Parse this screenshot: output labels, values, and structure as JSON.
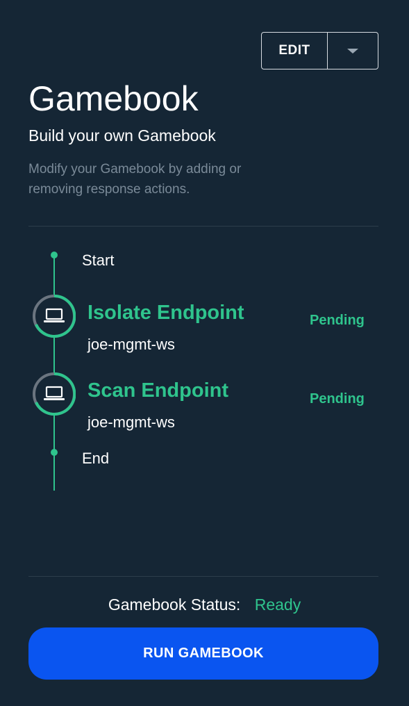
{
  "header": {
    "edit_label": "EDIT",
    "title": "Gamebook",
    "subtitle": "Build your own Gamebook",
    "description": "Modify your Gamebook by adding or removing response actions."
  },
  "timeline": {
    "start_label": "Start",
    "end_label": "End",
    "steps": [
      {
        "name": "Isolate Endpoint",
        "host": "joe-mgmt-ws",
        "status": "Pending",
        "icon": "laptop-icon"
      },
      {
        "name": "Scan Endpoint",
        "host": "joe-mgmt-ws",
        "status": "Pending",
        "icon": "laptop-icon"
      }
    ]
  },
  "footer": {
    "status_label": "Gamebook Status:",
    "status_value": "Ready",
    "run_label": "RUN GAMEBOOK"
  },
  "colors": {
    "background": "#152635",
    "accent_green": "#2fc48d",
    "primary_blue": "#0a55f0",
    "muted_text": "#7a8a98"
  }
}
